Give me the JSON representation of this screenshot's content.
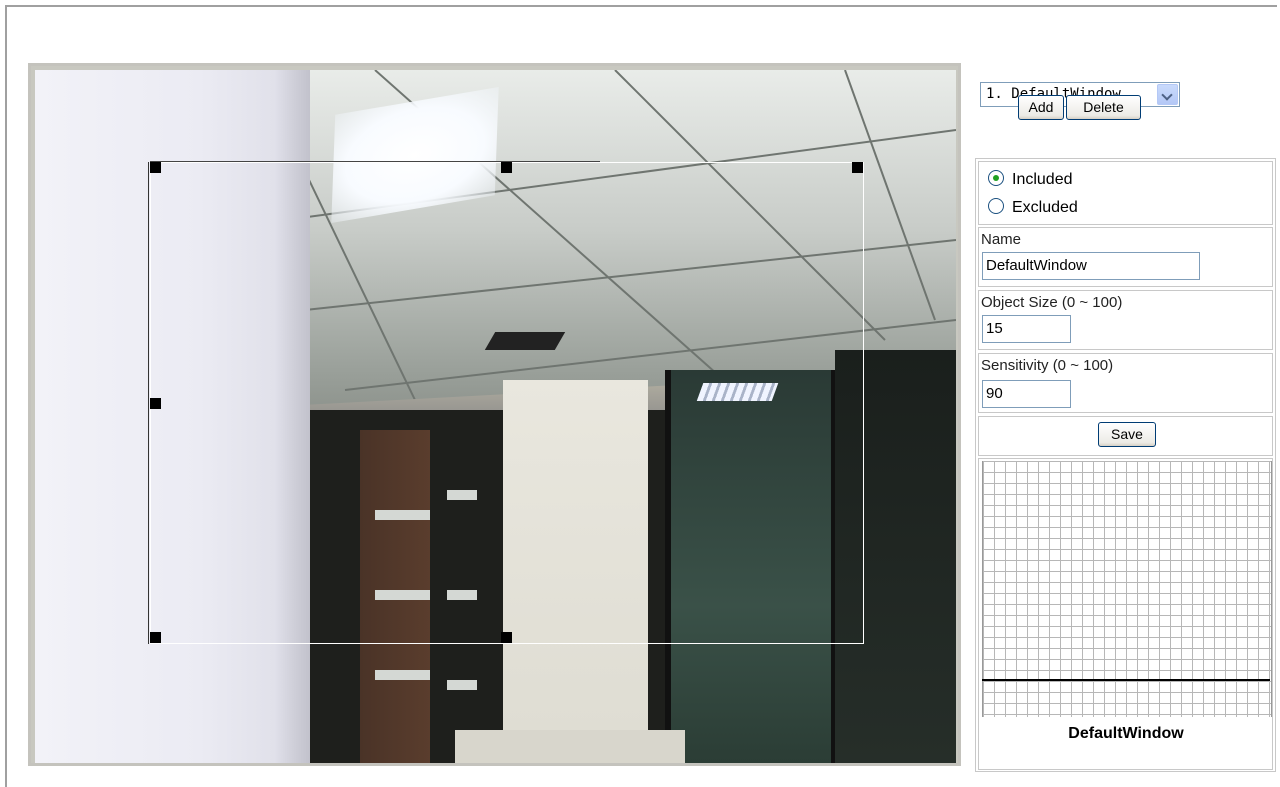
{
  "window_selector": {
    "selected": "1. DefaultWindow"
  },
  "buttons": {
    "add": "Add",
    "delete": "Delete",
    "save": "Save"
  },
  "mode": {
    "included": "Included",
    "excluded": "Excluded",
    "selected": "Included"
  },
  "fields": {
    "name_label": "Name",
    "name_value": "DefaultWindow",
    "object_size_label": "Object Size  (0 ~ 100)",
    "object_size_value": "15",
    "sensitivity_label": "Sensitivity  (0 ~ 100)",
    "sensitivity_value": "90"
  },
  "graph": {
    "window_name": "DefaultWindow",
    "threshold_level": 0.15
  },
  "colors": {
    "radio_dot": "#21a121",
    "button_border": "#003c74",
    "input_border": "#7f9db9"
  }
}
